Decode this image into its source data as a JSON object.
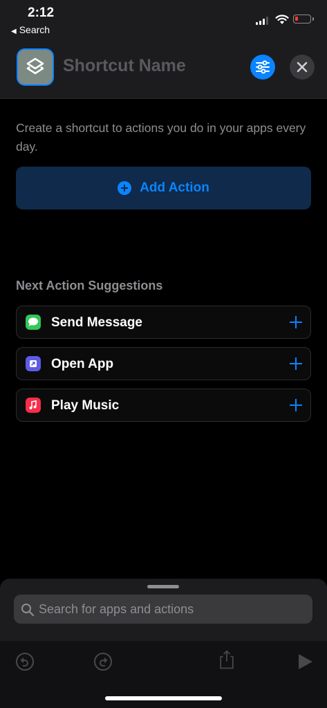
{
  "status_bar": {
    "time": "2:12",
    "back_app": "Search",
    "battery_color": "#ff3b30"
  },
  "header": {
    "title_placeholder": "Shortcut Name",
    "icon": "layers-icon",
    "settings_icon": "sliders-icon",
    "close_icon": "close-icon"
  },
  "main": {
    "description": "Create a shortcut to actions you do in your apps every day.",
    "add_action_label": "Add Action"
  },
  "suggestions": {
    "title": "Next Action Suggestions",
    "items": [
      {
        "label": "Send Message",
        "icon": "messages-icon",
        "color": "#34c759"
      },
      {
        "label": "Open App",
        "icon": "open-app-icon",
        "color": "#5e5ce6"
      },
      {
        "label": "Play Music",
        "icon": "music-icon",
        "color": "#fa2d48"
      }
    ]
  },
  "sheet": {
    "search_placeholder": "Search for apps and actions"
  },
  "colors": {
    "accent": "#0a84ff",
    "background": "#000000",
    "surface": "#1c1c1e"
  }
}
